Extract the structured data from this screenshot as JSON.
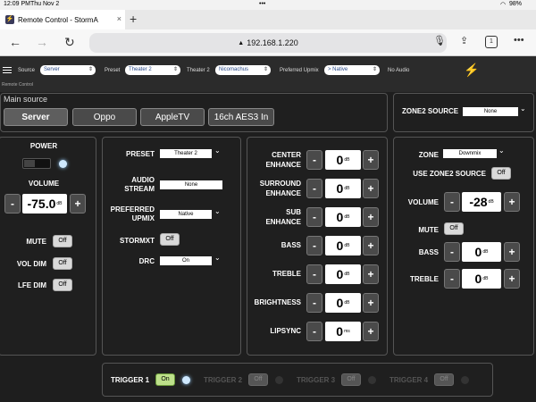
{
  "status": {
    "time": "12:09 PM",
    "date": "Thu Nov 2",
    "battery": "98%"
  },
  "browser": {
    "tab_title": "Remote Control - StormA",
    "url": "192.168.1.220",
    "tab_count": "1"
  },
  "header": {
    "labels": {
      "source": "Source",
      "preset": "Preset",
      "theater2": "Theater 2",
      "upmix": "Preferred Upmix"
    },
    "values": {
      "source": "Server",
      "preset": "Theater 2",
      "theater2": "Nicomachus",
      "upmix": "> Native"
    },
    "no_audio": "No Audio",
    "remote_label": "Remote Control"
  },
  "main_source": {
    "title": "Main source",
    "buttons": [
      "Server",
      "Oppo",
      "AppleTV",
      "16ch AES3 In"
    ],
    "active": "Server"
  },
  "zone2_source": {
    "label": "ZONE2 SOURCE",
    "value": "None"
  },
  "power_panel": {
    "power_label": "POWER",
    "volume_label": "VOLUME",
    "volume_value": "-75.0",
    "volume_unit": "dB",
    "mute_label": "MUTE",
    "mute_state": "Off",
    "voldim_label": "VOL DIM",
    "voldim_state": "Off",
    "lfedim_label": "LFE DIM",
    "lfedim_state": "Off"
  },
  "preset_panel": {
    "preset_label": "PRESET",
    "preset_value": "Theater 2",
    "audio_stream_label_1": "AUDIO",
    "audio_stream_label_2": "STREAM",
    "audio_stream_value": "None",
    "upmix_label_1": "PREFERRED",
    "upmix_label_2": "UPMIX",
    "upmix_value": "Native",
    "stormxt_label": "STORMXT",
    "stormxt_state": "Off",
    "drc_label": "DRC",
    "drc_value": "On"
  },
  "adjust_panel": {
    "rows": [
      {
        "l1": "CENTER",
        "l2": "ENHANCE",
        "value": "0",
        "unit": "dB"
      },
      {
        "l1": "SURROUND",
        "l2": "ENHANCE",
        "value": "0",
        "unit": "dB"
      },
      {
        "l1": "SUB",
        "l2": "ENHANCE",
        "value": "0",
        "unit": "dB"
      },
      {
        "l1": "BASS",
        "l2": "",
        "value": "0",
        "unit": "dB"
      },
      {
        "l1": "TREBLE",
        "l2": "",
        "value": "0",
        "unit": "dB"
      },
      {
        "l1": "BRIGHTNESS",
        "l2": "",
        "value": "0",
        "unit": "dB"
      },
      {
        "l1": "LIPSYNC",
        "l2": "",
        "value": "0",
        "unit": "ms"
      }
    ]
  },
  "zone_panel": {
    "zone_label": "ZONE",
    "zone_value": "Downmix",
    "use_zone2_label": "USE ZONE2 SOURCE",
    "use_zone2_state": "Off",
    "volume_label": "VOLUME",
    "volume_value": "-28",
    "volume_unit": "dB",
    "mute_label": "MUTE",
    "mute_state": "Off",
    "bass_label": "BASS",
    "bass_value": "0",
    "bass_unit": "dB",
    "treble_label": "TREBLE",
    "treble_value": "0",
    "treble_unit": "dB"
  },
  "triggers": [
    {
      "label": "TRIGGER 1",
      "state": "On"
    },
    {
      "label": "TRIGGER 2",
      "state": "Off"
    },
    {
      "label": "TRIGGER 3",
      "state": "Off"
    },
    {
      "label": "TRIGGER 4",
      "state": "Off"
    }
  ],
  "icons": {
    "plus": "+",
    "minus": "-",
    "chevron": "⌄"
  }
}
